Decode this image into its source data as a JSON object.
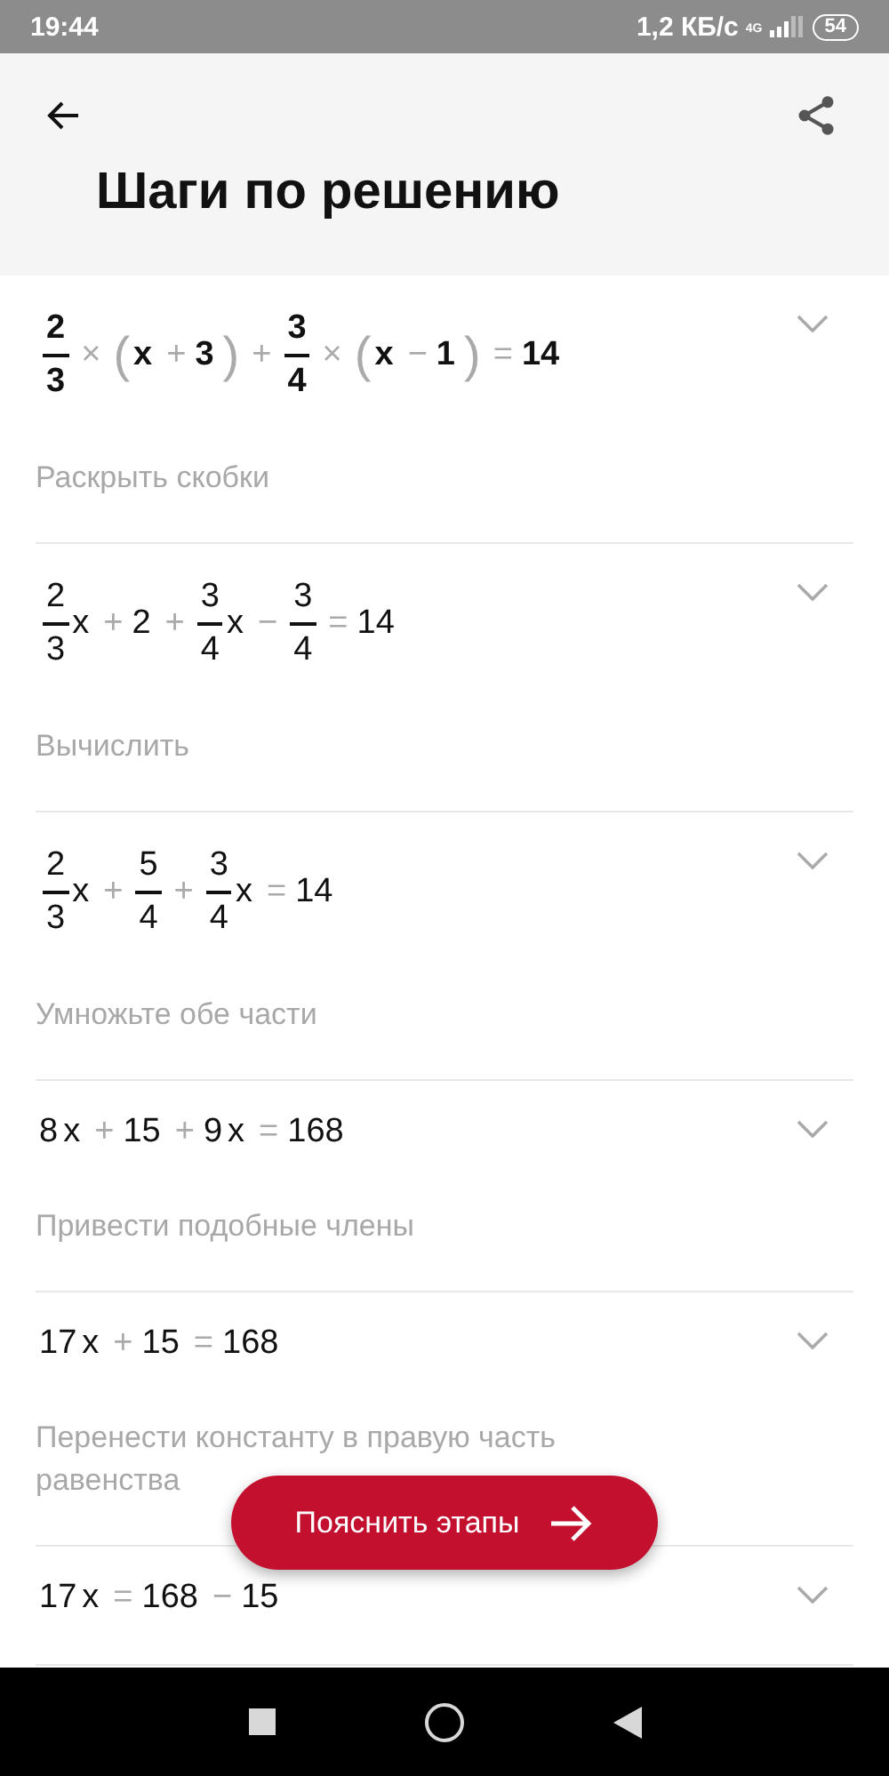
{
  "status_bar": {
    "time": "19:44",
    "speed": "1,2 КБ/с",
    "network": "4G",
    "battery": "54"
  },
  "header": {
    "title": "Шаги по решению"
  },
  "steps": [
    {
      "bold": true,
      "expanded": false,
      "description": "Раскрыть скобки",
      "expression": [
        {
          "kind": "frac",
          "num": "2",
          "den": "3"
        },
        {
          "kind": "op",
          "text": "×"
        },
        {
          "kind": "paren",
          "text": "("
        },
        {
          "kind": "term",
          "text": "x"
        },
        {
          "kind": "op",
          "text": "+"
        },
        {
          "kind": "term",
          "text": "3"
        },
        {
          "kind": "paren",
          "text": ")"
        },
        {
          "kind": "op",
          "text": "+"
        },
        {
          "kind": "frac",
          "num": "3",
          "den": "4"
        },
        {
          "kind": "op",
          "text": "×"
        },
        {
          "kind": "paren",
          "text": "("
        },
        {
          "kind": "term",
          "text": "x"
        },
        {
          "kind": "op",
          "text": "−"
        },
        {
          "kind": "term",
          "text": "1"
        },
        {
          "kind": "paren",
          "text": ")"
        },
        {
          "kind": "op",
          "text": "="
        },
        {
          "kind": "term",
          "text": "14"
        }
      ]
    },
    {
      "bold": false,
      "expanded": false,
      "description": "Вычислить",
      "expression": [
        {
          "kind": "frac",
          "num": "2",
          "den": "3"
        },
        {
          "kind": "term",
          "text": "x"
        },
        {
          "kind": "op",
          "text": "+"
        },
        {
          "kind": "term",
          "text": "2"
        },
        {
          "kind": "op",
          "text": "+"
        },
        {
          "kind": "frac",
          "num": "3",
          "den": "4"
        },
        {
          "kind": "term",
          "text": "x"
        },
        {
          "kind": "op",
          "text": "−"
        },
        {
          "kind": "frac",
          "num": "3",
          "den": "4"
        },
        {
          "kind": "op",
          "text": "="
        },
        {
          "kind": "term",
          "text": "14"
        }
      ]
    },
    {
      "bold": false,
      "expanded": false,
      "description": "Умножьте обе части",
      "expression": [
        {
          "kind": "frac",
          "num": "2",
          "den": "3"
        },
        {
          "kind": "term",
          "text": "x"
        },
        {
          "kind": "op",
          "text": "+"
        },
        {
          "kind": "frac",
          "num": "5",
          "den": "4"
        },
        {
          "kind": "op",
          "text": "+"
        },
        {
          "kind": "frac",
          "num": "3",
          "den": "4"
        },
        {
          "kind": "term",
          "text": "x"
        },
        {
          "kind": "op",
          "text": "="
        },
        {
          "kind": "term",
          "text": "14"
        }
      ]
    },
    {
      "bold": false,
      "expanded": false,
      "description": "Привести подобные члены",
      "expression": [
        {
          "kind": "term",
          "text": "8"
        },
        {
          "kind": "term",
          "text": "x"
        },
        {
          "kind": "op",
          "text": "+"
        },
        {
          "kind": "term",
          "text": "15"
        },
        {
          "kind": "op",
          "text": "+"
        },
        {
          "kind": "term",
          "text": "9"
        },
        {
          "kind": "term",
          "text": "x"
        },
        {
          "kind": "op",
          "text": "="
        },
        {
          "kind": "term",
          "text": "168"
        }
      ]
    },
    {
      "bold": false,
      "expanded": false,
      "description": "Перенести константу в правую часть равенства",
      "expression": [
        {
          "kind": "term",
          "text": "17"
        },
        {
          "kind": "term",
          "text": "x"
        },
        {
          "kind": "op",
          "text": "+"
        },
        {
          "kind": "term",
          "text": "15"
        },
        {
          "kind": "op",
          "text": "="
        },
        {
          "kind": "term",
          "text": "168"
        }
      ]
    },
    {
      "bold": false,
      "expanded": false,
      "expression": [
        {
          "kind": "term",
          "text": "17"
        },
        {
          "kind": "term",
          "text": "x"
        },
        {
          "kind": "op",
          "text": "="
        },
        {
          "kind": "term",
          "text": "168"
        },
        {
          "kind": "op",
          "text": "−"
        },
        {
          "kind": "term",
          "text": "15"
        }
      ]
    }
  ],
  "fab": {
    "label": "Пояснить этапы"
  }
}
